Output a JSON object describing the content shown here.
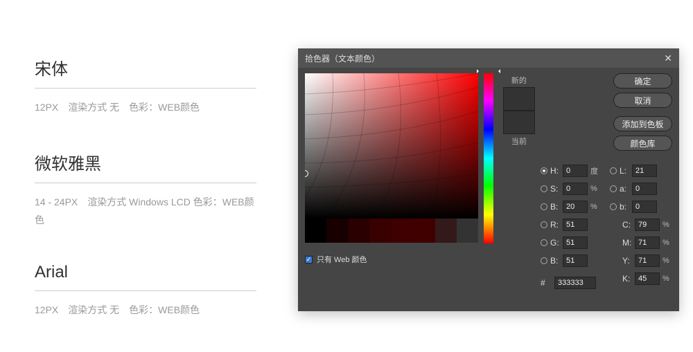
{
  "fonts": [
    {
      "title": "宋体",
      "desc": "12PX　渲染方式 无　色彩：WEB颜色"
    },
    {
      "title": "微软雅黑",
      "desc": "14 - 24PX　渲染方式 Windows LCD 色彩：WEB颜色"
    },
    {
      "title": "Arial",
      "desc": "12PX　渲染方式 无　色彩：WEB颜色"
    }
  ],
  "picker": {
    "title": "拾色器（文本颜色）",
    "buttons": {
      "ok": "确定",
      "cancel": "取消",
      "add": "添加到色板",
      "lib": "颜色库"
    },
    "labels": {
      "new": "新的",
      "current": "当前",
      "webonly": "只有 Web 颜色"
    },
    "colors": {
      "new": "#333333",
      "current": "#333333",
      "hex": "333333"
    },
    "hsb": {
      "h": "0",
      "s": "0",
      "b": "20"
    },
    "lab": {
      "l": "21",
      "a": "0",
      "b": "0"
    },
    "rgb": {
      "r": "51",
      "g": "51",
      "b": "51"
    },
    "cmyk": {
      "c": "79",
      "m": "71",
      "y": "71",
      "k": "45"
    },
    "units": {
      "deg": "度",
      "pct": "%"
    },
    "swatches": [
      "#000000",
      "#190000",
      "#2a0000",
      "#390000",
      "#3e0000",
      "#410000",
      "#331919",
      "#333333"
    ]
  }
}
